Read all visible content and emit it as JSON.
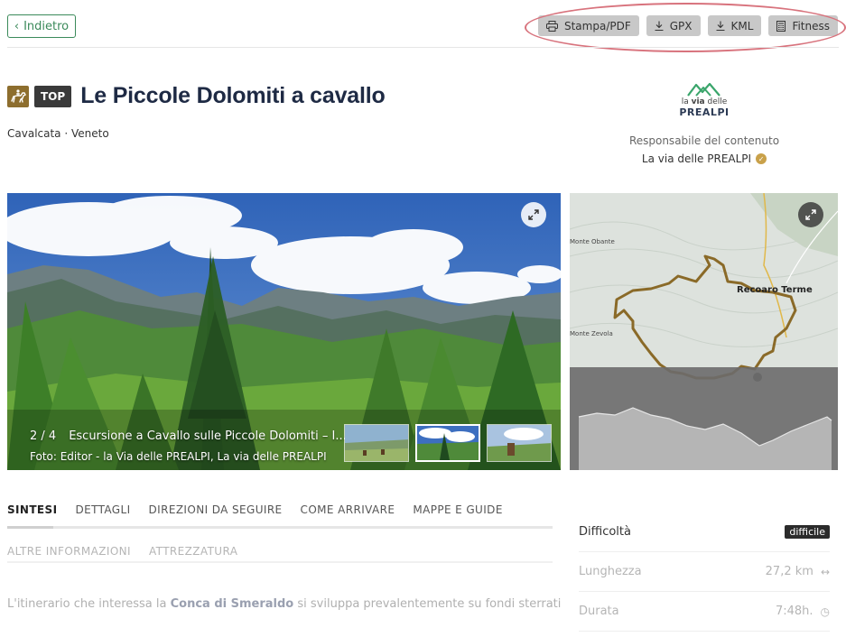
{
  "nav": {
    "back_label": "Indietro"
  },
  "toolbar": {
    "print_label": "Stampa/PDF",
    "gpx_label": "GPX",
    "kml_label": "KML",
    "fitness_label": "Fitness"
  },
  "header": {
    "category_icon": "horse-riding-icon",
    "badge": "TOP",
    "title": "Le Piccole Dolomiti a cavallo",
    "subtitle": "Cavalcata · Veneto"
  },
  "publisher": {
    "logo_line1_prefix": "la ",
    "logo_line1_bold": "via",
    "logo_line1_suffix": " delle",
    "logo_line2": "PREALPI",
    "responsible_label": "Responsabile del contenuto",
    "responsible_name": "La via delle PREALPI"
  },
  "gallery": {
    "counter": "2 / 4",
    "caption": "Escursione a Cavallo sulle Piccole Dolomiti – I...",
    "credit": "Foto: Editor - la Via delle PREALPI, La via delle PREALPI",
    "active_thumb": 2
  },
  "map": {
    "labels": [
      "Monte Obante",
      "Recoaro Terme",
      "Monte Zevola"
    ]
  },
  "tabs": {
    "row1": [
      "SINTESI",
      "DETTAGLI",
      "DIREZIONI DA SEGUIRE",
      "COME ARRIVARE",
      "MAPPE E GUIDE"
    ],
    "row2": [
      "ALTRE INFORMAZIONI",
      "ATTREZZATURA"
    ],
    "active": "SINTESI"
  },
  "intro": {
    "before": "L'itinerario che interessa la ",
    "bold": "Conca di Smeraldo",
    "after": " si sviluppa prevalentemente su fondi sterrati"
  },
  "stats": {
    "difficulty_label": "Difficoltà",
    "difficulty_value": "difficile",
    "length_label": "Lunghezza",
    "length_value": "27,2 km",
    "duration_label": "Durata",
    "duration_value": "7:48h."
  },
  "colors": {
    "accent_green": "#3b8a5a",
    "highlight_oval": "#d8737d",
    "route": "#8a6a28"
  }
}
